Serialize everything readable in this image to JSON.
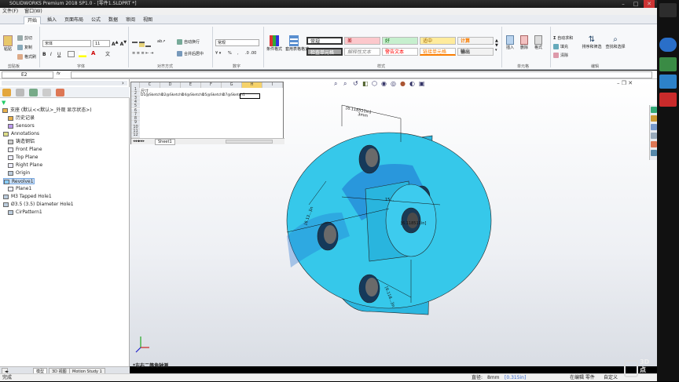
{
  "window": {
    "title": "SOLIDWORKS Premium 2018 SP1.0 - [零件1.SLDPRT *]"
  },
  "menubar": [
    "文件(F)",
    "窗口(W)"
  ],
  "ribbon": {
    "tabs": [
      "开始",
      "插入",
      "页面布局",
      "公式",
      "数据",
      "审阅",
      "视图"
    ],
    "active_tab": "开始",
    "clipboard": {
      "paste": "粘贴",
      "cut": "剪切",
      "copy": "复制",
      "format_painter": "格式刷",
      "label": "剪贴板"
    },
    "font": {
      "name": "宋体",
      "size": "11",
      "bold": "B",
      "italic": "I",
      "underline": "U",
      "label": "字体"
    },
    "alignment": {
      "wrap": "自动换行",
      "merge": "合并后居中",
      "label": "对齐方式"
    },
    "number": {
      "format": "常规",
      "percent": "%",
      "comma": ",",
      "label": "数字"
    },
    "styles": {
      "cond_format": "条件格式",
      "table_format": "套用表格格式",
      "label": "样式",
      "cells": [
        [
          "常规",
          "差",
          "好",
          "适中",
          "计算"
        ],
        [
          "检查单元格",
          "解释性文本",
          "警告文本",
          "链接单元格",
          "输出"
        ]
      ]
    },
    "cells_group": {
      "insert": "插入",
      "delete": "删除",
      "format": "格式",
      "label": "单元格"
    },
    "editing": {
      "autosum": "自动求和",
      "fill": "填充",
      "clear": "清除",
      "sort": "排序和筛选",
      "find": "查找和选择",
      "label": "编辑"
    }
  },
  "formula_bar": {
    "name_box": "E2",
    "fx": "fx",
    "value": ""
  },
  "sheet": {
    "columns": [
      "C",
      "D",
      "E",
      "F",
      "G",
      "H",
      "I"
    ],
    "rows": [
      "1",
      "2",
      "3",
      "4",
      "5",
      "6",
      "7",
      "8",
      "9",
      "10",
      "11",
      "12"
    ],
    "a1": "尺寸",
    "row2": [
      "D1@Sketch1",
      "D2@Sketch1",
      "D4@Sketch1",
      "D5@Sketch1",
      "D7@Sketch1"
    ],
    "tab": "Sheet1"
  },
  "tree": {
    "root": "支座 (默认<<默认>_外观 显示状态>)",
    "items": [
      "历史记录",
      "Sensors",
      "Annotations",
      "铸造钢铝",
      "Front Plane",
      "Top Plane",
      "Right Plane",
      "Origin",
      "Revolve1",
      "Plane1",
      "M3 Tapped Hole1",
      "Ø3.5 (3.5) Diameter Hole1",
      "CirPattern1"
    ],
    "selected": "Revolve1"
  },
  "viewport": {
    "view_label": "*左右二等角轴测",
    "dims": [
      "[6.118511in]",
      "3mm",
      "[6.13...]in",
      "15...",
      "[6.118...]in",
      "[6.118511in]",
      "3mm"
    ],
    "model_color": "#33c4e6",
    "shadow_color": "#1d5fb8"
  },
  "bottom_tabs": [
    "模型",
    "3D 视图",
    "Motion Study 1"
  ],
  "status": {
    "left": "完成",
    "measure_label": "直径:",
    "measure_value": "8mm",
    "measure_inch": "[0.315in]",
    "editing": "在编辑 零件",
    "custom": "自定义"
  }
}
